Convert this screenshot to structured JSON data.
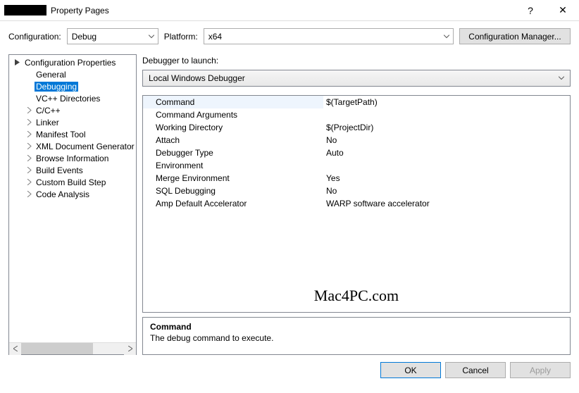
{
  "window": {
    "title": "Property Pages",
    "help": "?",
    "close": "✕"
  },
  "config": {
    "configuration_label": "Configuration:",
    "configuration_value": "Debug",
    "platform_label": "Platform:",
    "platform_value": "x64",
    "manager_button": "Configuration Manager..."
  },
  "tree": {
    "root": "Configuration Properties",
    "items": [
      {
        "label": "General",
        "expandable": false
      },
      {
        "label": "Debugging",
        "expandable": false,
        "selected": true
      },
      {
        "label": "VC++ Directories",
        "expandable": false
      },
      {
        "label": "C/C++",
        "expandable": true
      },
      {
        "label": "Linker",
        "expandable": true
      },
      {
        "label": "Manifest Tool",
        "expandable": true
      },
      {
        "label": "XML Document Generator",
        "expandable": true
      },
      {
        "label": "Browse Information",
        "expandable": true
      },
      {
        "label": "Build Events",
        "expandable": true
      },
      {
        "label": "Custom Build Step",
        "expandable": true
      },
      {
        "label": "Code Analysis",
        "expandable": true
      }
    ]
  },
  "debugger": {
    "launch_label": "Debugger to launch:",
    "launch_value": "Local Windows Debugger"
  },
  "props": [
    {
      "name": "Command",
      "value": "$(TargetPath)",
      "selected": true
    },
    {
      "name": "Command Arguments",
      "value": ""
    },
    {
      "name": "Working Directory",
      "value": "$(ProjectDir)"
    },
    {
      "name": "Attach",
      "value": "No"
    },
    {
      "name": "Debugger Type",
      "value": "Auto"
    },
    {
      "name": "Environment",
      "value": ""
    },
    {
      "name": "Merge Environment",
      "value": "Yes"
    },
    {
      "name": "SQL Debugging",
      "value": "No"
    },
    {
      "name": "Amp Default Accelerator",
      "value": "WARP software accelerator"
    }
  ],
  "watermark": "Mac4PC.com",
  "help": {
    "title": "Command",
    "text": "The debug command to execute."
  },
  "footer": {
    "ok": "OK",
    "cancel": "Cancel",
    "apply": "Apply"
  }
}
